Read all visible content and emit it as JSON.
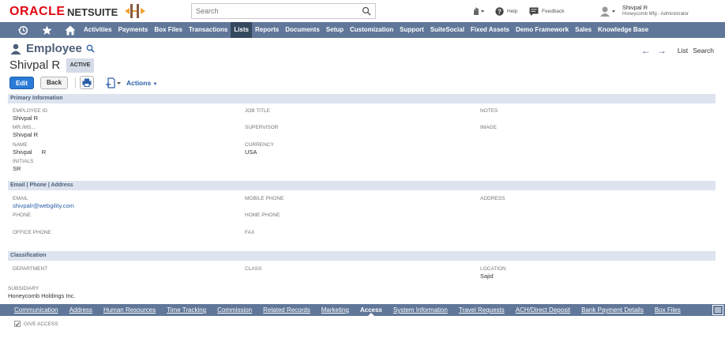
{
  "header": {
    "logo_oracle": "ORACLE",
    "logo_netsuite": "NETSUITE",
    "search_placeholder": "Search",
    "help": "Help",
    "feedback": "Feedback",
    "user_name": "Shivpal R",
    "user_role": "Honeycomb Mfg - Administrator"
  },
  "nav": {
    "items": [
      "Activities",
      "Payments",
      "Box Files",
      "Transactions",
      "Lists",
      "Reports",
      "Documents",
      "Setup",
      "Customization",
      "Support",
      "SuiteSocial",
      "Fixed Assets",
      "Demo Framework",
      "Sales",
      "Knowledge Base"
    ],
    "active": "Lists"
  },
  "record": {
    "type_title": "Employee",
    "name": "Shivpal R",
    "status": "ACTIVE",
    "nav_list": "List",
    "nav_search": "Search"
  },
  "buttons": {
    "edit": "Edit",
    "back": "Back",
    "actions": "Actions"
  },
  "sections": {
    "primary": "Primary Information",
    "contact": "Email | Phone | Address",
    "classification": "Classification"
  },
  "fields": {
    "employee_id_label": "EMPLOYEE ID",
    "employee_id": "Shivpal R",
    "mr_ms_label": "MR./MS...",
    "mr_ms": "Shivpal R",
    "name_label": "NAME",
    "name_first": "Shivpal",
    "name_last": "R",
    "initials_label": "INITIALS",
    "initials": "SR",
    "job_title_label": "JOB TITLE",
    "supervisor_label": "SUPERVISOR",
    "currency_label": "CURRENCY",
    "currency": "USA",
    "notes_label": "NOTES",
    "image_label": "IMAGE",
    "email_label": "EMAIL",
    "email": "shivpalr@webgility.com",
    "phone_label": "PHONE",
    "office_phone_label": "OFFICE PHONE",
    "mobile_phone_label": "MOBILE PHONE",
    "home_phone_label": "HOME PHONE",
    "fax_label": "FAX",
    "address_label": "ADDRESS",
    "department_label": "DEPARTMENT",
    "class_label": "CLASS",
    "location_label": "LOCATION",
    "location": "Sajid",
    "subsidiary_label": "SUBSIDIARY",
    "subsidiary": "Honeycomb Holdings Inc."
  },
  "subtabs": {
    "items": [
      "Communication",
      "Address",
      "Human Resources",
      "Time Tracking",
      "Commission",
      "Related Records",
      "Marketing",
      "Access",
      "System Information",
      "Travel Requests",
      "ACH/Direct Deposit",
      "Bank Payment Details",
      "Box Files"
    ],
    "active": "Access"
  },
  "access": {
    "give_access": "GIVE ACCESS"
  },
  "colors": {
    "nav_bg": "#607799",
    "nav_active": "#34495e",
    "section_bg": "#dde4ef",
    "edit_button": "#2a7ad8",
    "oracle_red": "#e30613"
  }
}
